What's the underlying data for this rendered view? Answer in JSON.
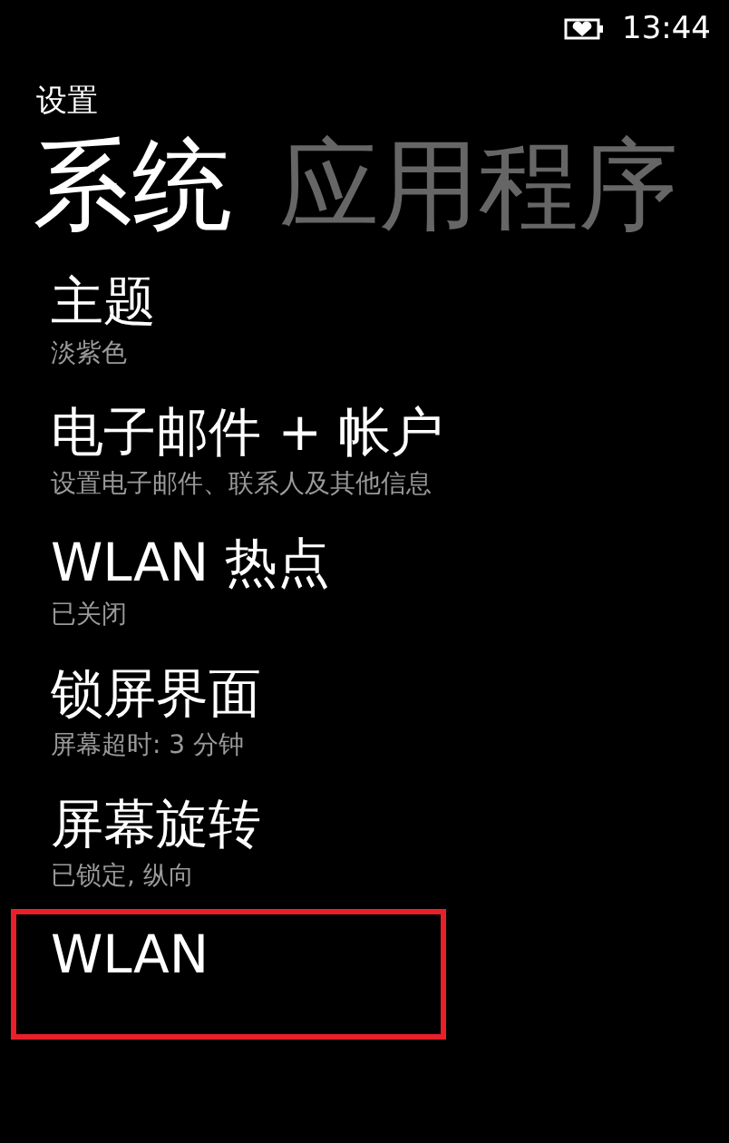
{
  "status_bar": {
    "time": "13:44"
  },
  "app_title": "设置",
  "pivots": [
    {
      "label": "系统",
      "selected": true
    },
    {
      "label": "应用程序",
      "selected": false
    }
  ],
  "items": [
    {
      "title": "主题",
      "subtitle": "淡紫色",
      "highlighted": false
    },
    {
      "title": "电子邮件 + 帐户",
      "subtitle": "设置电子邮件、联系人及其他信息",
      "highlighted": false
    },
    {
      "title": "WLAN 热点",
      "subtitle": "已关闭",
      "highlighted": false
    },
    {
      "title": "锁屏界面",
      "subtitle": "屏幕超时: 3 分钟",
      "highlighted": false
    },
    {
      "title": "屏幕旋转",
      "subtitle": "已锁定, 纵向",
      "highlighted": false
    },
    {
      "title": "WLAN",
      "highlighted": true
    }
  ]
}
